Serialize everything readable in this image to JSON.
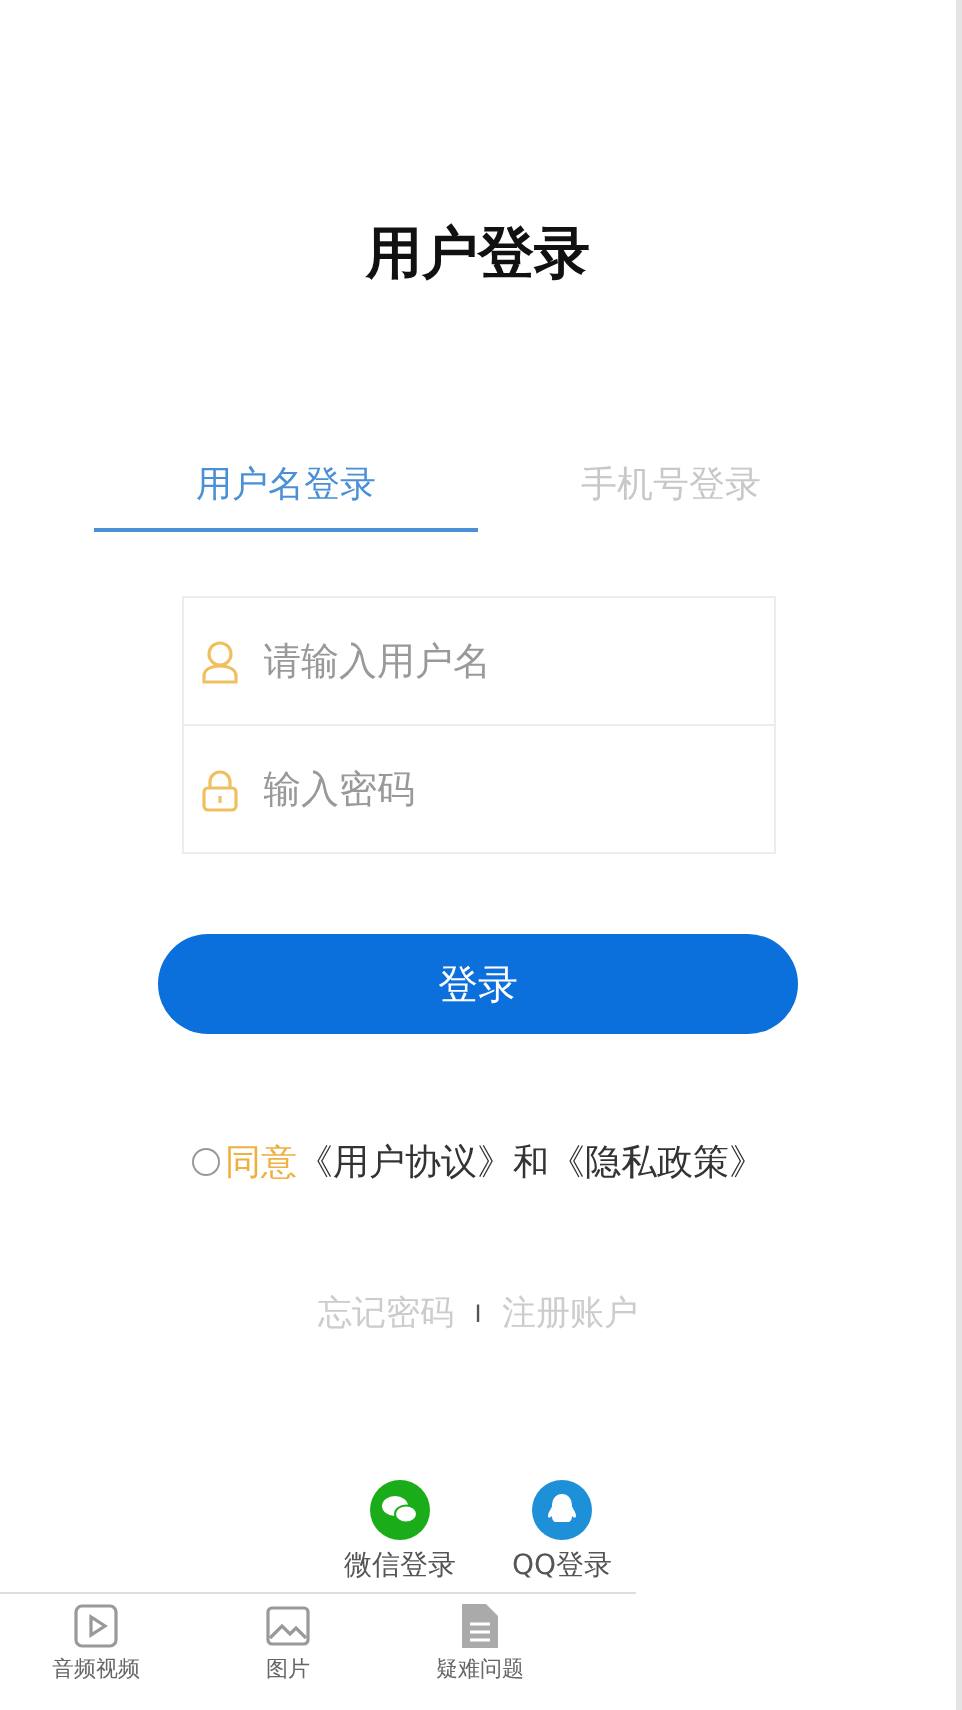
{
  "title": "用户登录",
  "tabs": [
    {
      "label": "用户名登录",
      "selected": true
    },
    {
      "label": "手机号登录",
      "selected": false
    }
  ],
  "fields": [
    {
      "kind": "user",
      "placeholder": "请输入用户名"
    },
    {
      "kind": "lock",
      "placeholder": "输入密码"
    }
  ],
  "login_button": "登录",
  "agreement": {
    "checked": false,
    "agree": "同意",
    "text": "《用户协议》和《隐私政策》"
  },
  "links": [
    "忘记密码",
    "注册账户"
  ],
  "link_separator": "I",
  "social": [
    {
      "kind": "wechat",
      "label": "微信登录"
    },
    {
      "kind": "qq",
      "label": "QQ登录"
    }
  ],
  "nav": [
    {
      "kind": "video",
      "label": "音频视频"
    },
    {
      "kind": "image",
      "label": "图片"
    },
    {
      "kind": "doc",
      "label": "疑难问题"
    }
  ]
}
